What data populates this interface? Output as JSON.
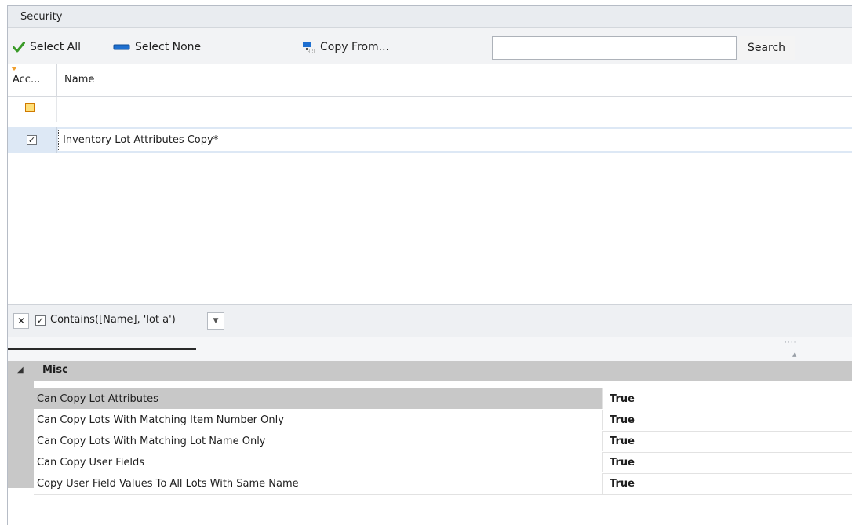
{
  "panel": {
    "title": "Security"
  },
  "toolbar": {
    "select_all": "Select All",
    "select_none": "Select None",
    "copy_from": "Copy From...",
    "search_value": "",
    "search_button": "Search",
    "icons": {
      "select_all": "check-icon",
      "select_none": "deselect-icon",
      "copy_from": "copy-from-icon"
    }
  },
  "grid": {
    "columns": [
      "Acc...",
      "Name"
    ],
    "rows": [
      {
        "checked": true,
        "name": "Inventory Lot Attributes Copy*"
      }
    ]
  },
  "filter": {
    "enabled": true,
    "expression": "Contains([Name], 'lot a')"
  },
  "properties": {
    "category": "Misc",
    "items": [
      {
        "name": "Can Copy Lot Attributes",
        "value": "True"
      },
      {
        "name": "Can Copy Lots With Matching Item Number Only",
        "value": "True"
      },
      {
        "name": "Can Copy Lots With Matching Lot Name Only",
        "value": "True"
      },
      {
        "name": "Can Copy User Fields",
        "value": "True"
      },
      {
        "name": "Copy User Field Values To All Lots With Same Name",
        "value": "True"
      }
    ]
  },
  "colors": {
    "selected_row": "#dde8f5",
    "toolbar_bg": "#f2f3f5",
    "category_bg": "#c8c8c8",
    "check_green": "#3a9a28",
    "select_none_blue": "#1e6fd0"
  }
}
